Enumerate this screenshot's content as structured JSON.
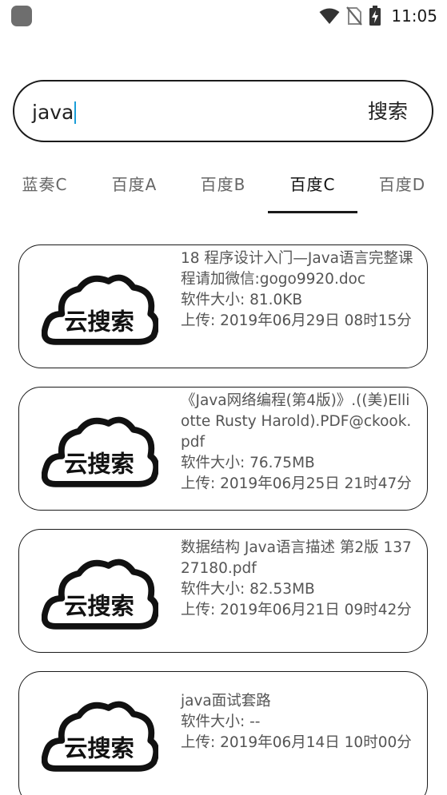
{
  "status_bar": {
    "time": "11:05",
    "icons": [
      "wifi-icon",
      "no-sim-icon",
      "battery-charging-icon"
    ]
  },
  "search": {
    "value": "java",
    "button_label": "搜索"
  },
  "tabs": [
    {
      "label": "蓝奏C",
      "active": false
    },
    {
      "label": "百度A",
      "active": false
    },
    {
      "label": "百度B",
      "active": false
    },
    {
      "label": "百度C",
      "active": true
    },
    {
      "label": "百度D",
      "active": false
    }
  ],
  "logo_text": "云搜索",
  "results": [
    {
      "title": "18 程序设计入门—Java语言完整课程请加微信:gogo9920.doc",
      "size": "软件大小: 81.0KB",
      "upload": "上传: 2019年06月29日 08时15分"
    },
    {
      "title": "《Java网络编程(第4版)》.((美)Elliotte Rusty Harold).PDF@ckook.pdf",
      "size": "软件大小: 76.75MB",
      "upload": "上传: 2019年06月25日 21时47分"
    },
    {
      "title": "数据结构 Java语言描述 第2版 13727180.pdf",
      "size": "软件大小: 82.53MB",
      "upload": "上传: 2019年06月21日 09时42分"
    },
    {
      "title": "java面试套路",
      "size": "软件大小: --",
      "upload": "上传: 2019年06月14日 10时00分"
    }
  ]
}
